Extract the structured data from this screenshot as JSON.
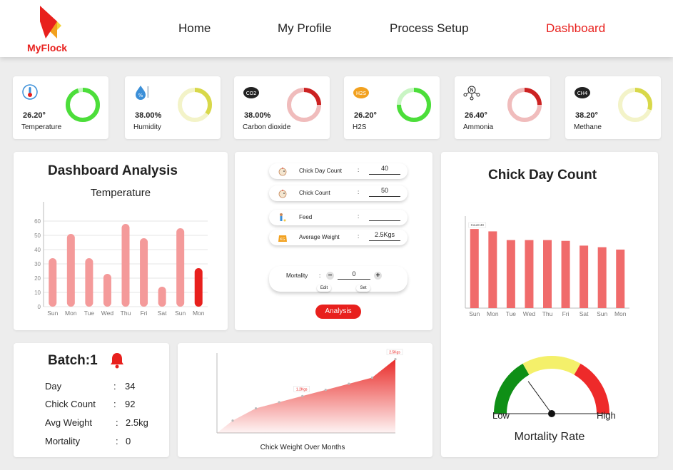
{
  "brand": {
    "name": "MyFlock"
  },
  "nav": {
    "home": "Home",
    "profile": "My Profile",
    "process": "Process Setup",
    "dashboard": "Dashboard"
  },
  "sensors": [
    {
      "value": "26.20°",
      "label": "Temperature",
      "icon": "thermometer-icon",
      "ring_color": "#4cde3a",
      "ring_fill": 0.95
    },
    {
      "value": "38.00%",
      "label": "Humidity",
      "icon": "humidity-icon",
      "ring_color": "#d8d84a",
      "ring_fill": 0.35
    },
    {
      "value": "38.00%",
      "label": "Carbon dioxide",
      "icon": "co2-icon",
      "icon_text": "CO2",
      "ring_color": "#cc2222",
      "ring_fill": 0.25
    },
    {
      "value": "26.20°",
      "label": "H2S",
      "icon": "h2s-icon",
      "icon_text": "H2S",
      "ring_color": "#4cde3a",
      "ring_fill": 0.75
    },
    {
      "value": "26.40°",
      "label": "Ammonia",
      "icon": "ammonia-molecule-icon",
      "icon_text": "N",
      "ring_color": "#cc2222",
      "ring_fill": 0.25
    },
    {
      "value": "38.20°",
      "label": "Methane",
      "icon": "methane-icon",
      "icon_text": "CH4",
      "ring_color": "#d8d84a",
      "ring_fill": 0.3
    }
  ],
  "analysis": {
    "title": "Dashboard Analysis",
    "chart_data": {
      "type": "bar",
      "title": "Temperature",
      "categories": [
        "Sun",
        "Mon",
        "Tue",
        "Wed",
        "Thu",
        "Fri",
        "Sat",
        "Sun",
        "Mon"
      ],
      "values": [
        34,
        51,
        34,
        23,
        58,
        48,
        14,
        55,
        27
      ],
      "yticks": [
        0,
        10,
        20,
        30,
        40,
        50,
        60
      ],
      "ylim": [
        0,
        65
      ],
      "bar_color": "#f49a9a",
      "highlight_color": "#e8201d",
      "highlight_index": 8
    }
  },
  "form": {
    "rows": [
      {
        "label": "Chick Day Count",
        "value": "40",
        "icon": "chick-icon"
      },
      {
        "label": "Chick Count",
        "value": "50",
        "icon": "chick-icon"
      },
      {
        "label": "Feed",
        "value": "",
        "icon": "feed-icon"
      },
      {
        "label": "Average Weight",
        "value": "2.5Kgs",
        "icon": "kg-weight-icon",
        "icon_text": "KG"
      }
    ],
    "colon": ":",
    "mortality_label": "Mortality",
    "mortality_value": "0",
    "minus": "−",
    "plus": "+",
    "edit_label": "Edit",
    "set_label": "Set",
    "analysis_button": "Analysis"
  },
  "chick_day": {
    "title": "Chick Day Count",
    "chart_data": {
      "type": "bar",
      "categories": [
        "Sun",
        "Mon",
        "Tue",
        "Wed",
        "Thu",
        "Fri",
        "Sat",
        "Sun",
        "Mon"
      ],
      "values": [
        100,
        97,
        86,
        86,
        86,
        85,
        79,
        77,
        74
      ],
      "ylim": [
        0,
        110
      ],
      "bar_color": "#f06b6b",
      "annotation": "Count:40"
    }
  },
  "gauge": {
    "low": "Low",
    "high": "High",
    "title": "Mortality Rate",
    "level": 0.3,
    "colors": [
      "#0f8f16",
      "#f4f06a",
      "#ee2a2a"
    ]
  },
  "batch": {
    "title": "Batch:1",
    "colon": ":",
    "rows": [
      {
        "label": "Day",
        "value": "34"
      },
      {
        "label": "Chick Count",
        "value": "92"
      },
      {
        "label": "Avg Weight",
        "value": "2.5kg"
      },
      {
        "label": "Mortality",
        "value": "0"
      }
    ]
  },
  "weight": {
    "chart_data": {
      "type": "area",
      "title": "Chick Weight Over Months",
      "values": [
        0.4,
        0.8,
        1.0,
        1.2,
        1.4,
        1.6,
        1.8,
        2.4
      ],
      "annotations": [
        {
          "index": 3,
          "text": "1.2Kgs"
        },
        {
          "index": 7,
          "text": "2.5Kgs"
        }
      ],
      "ylim": [
        0,
        2.6
      ],
      "color": "#e8201d"
    }
  }
}
